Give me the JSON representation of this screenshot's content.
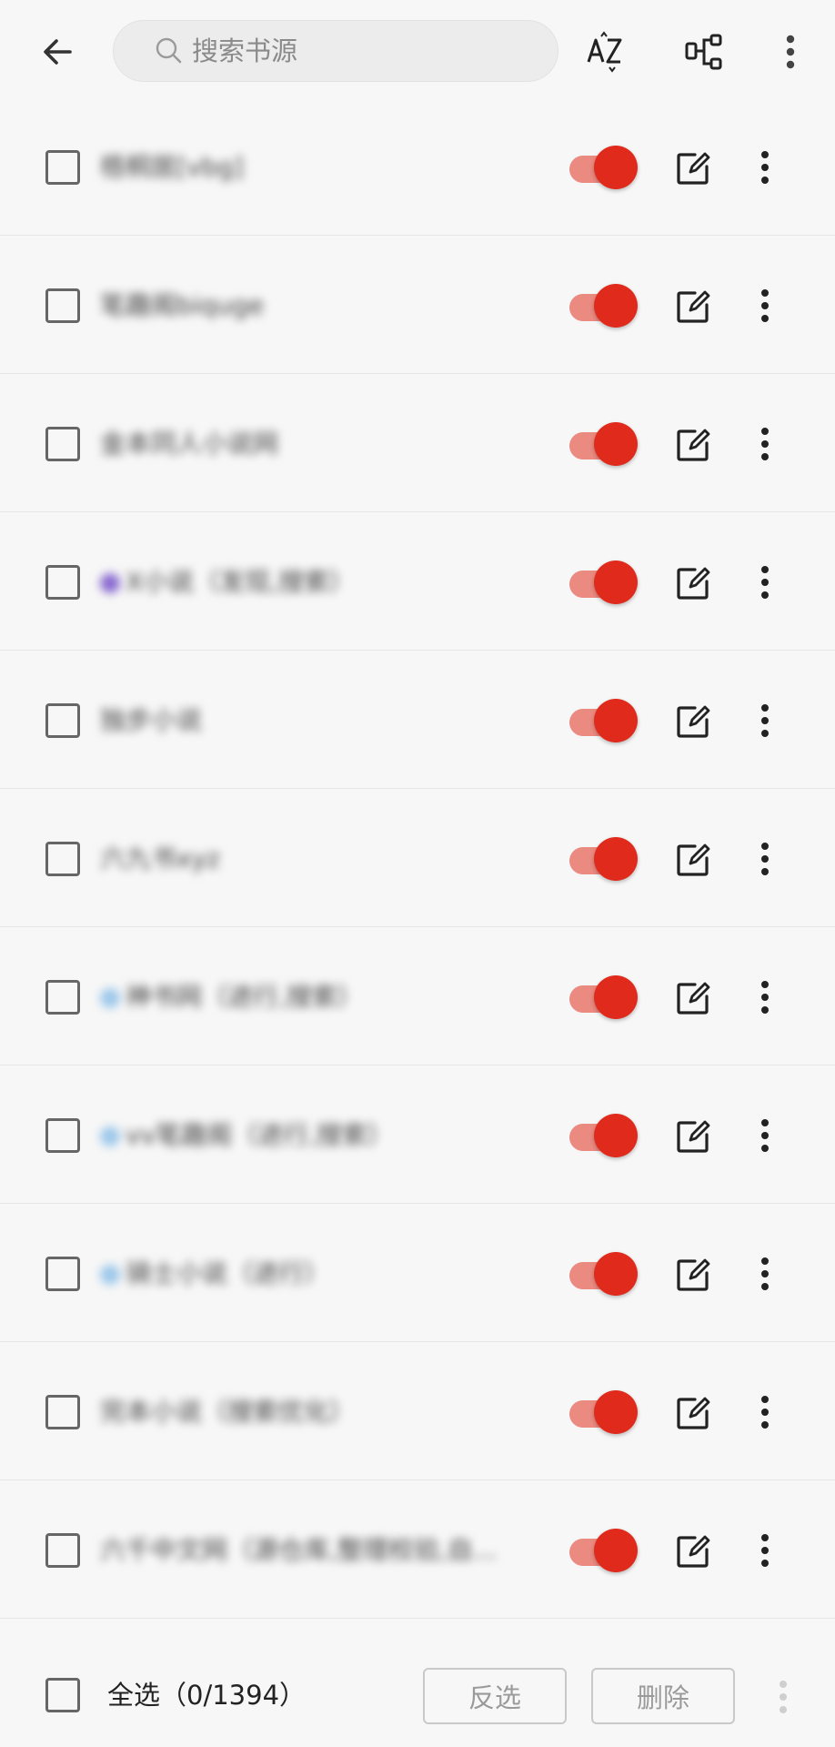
{
  "header": {
    "back_icon": "arrow-left-icon",
    "search_placeholder": "搜索书源",
    "search_value": "",
    "sort_icon": "sort-az-icon",
    "group_icon": "group-tree-icon",
    "more_icon": "more-vertical-icon"
  },
  "colors": {
    "accent": "#e02a1c",
    "accent_track": "#ea8a80",
    "background": "#f7f7f7"
  },
  "sources": [
    {
      "name": "梧桐居[vbg]",
      "enabled": true,
      "checked": false,
      "dot": ""
    },
    {
      "name": "笔趣阁biquge",
      "enabled": true,
      "checked": false,
      "dot": ""
    },
    {
      "name": "金本同人小说网",
      "enabled": true,
      "checked": false,
      "dot": ""
    },
    {
      "name": "X小说（发现,搜索）",
      "enabled": true,
      "checked": false,
      "dot": "#8a6ad0"
    },
    {
      "name": "独步小说",
      "enabled": true,
      "checked": false,
      "dot": ""
    },
    {
      "name": "六九书xyz",
      "enabled": true,
      "checked": false,
      "dot": ""
    },
    {
      "name": "神书网（进行,搜索）",
      "enabled": true,
      "checked": false,
      "dot": "#9cc8ea"
    },
    {
      "name": "vv笔趣阁（进行,搜索）",
      "enabled": true,
      "checked": false,
      "dot": "#9cc8ea"
    },
    {
      "name": "骑士小说（进行）",
      "enabled": true,
      "checked": false,
      "dot": "#9cc8ea"
    },
    {
      "name": "完本小说（搜索优化）",
      "enabled": true,
      "checked": false,
      "dot": ""
    },
    {
      "name": "六千中文网（源仓库,整理校验,自...",
      "enabled": true,
      "checked": false,
      "dot": ""
    }
  ],
  "footer": {
    "select_all_label": "全选（0/1394）",
    "invert_label": "反选",
    "delete_label": "删除",
    "more_icon": "more-vertical-icon"
  }
}
